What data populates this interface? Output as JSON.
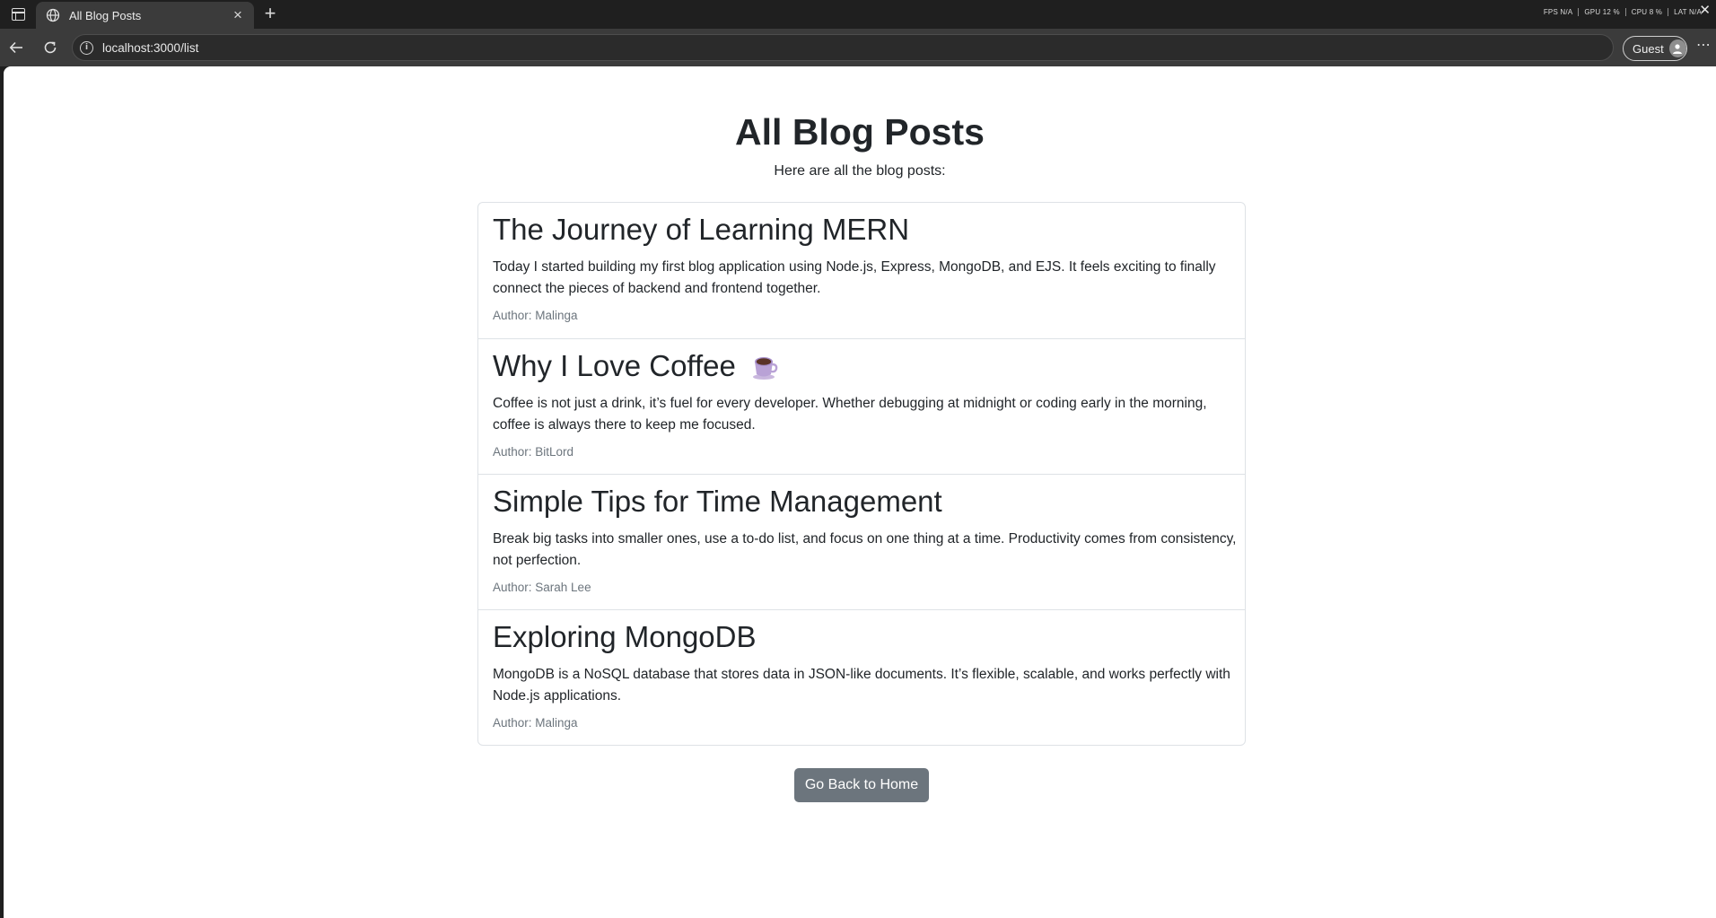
{
  "browser": {
    "tab": {
      "title": "All Blog Posts",
      "close_glyph": "×"
    },
    "new_tab_glyph": "+",
    "perf": [
      "FPS N/A",
      "GPU 12 %",
      "CPU 8 %",
      "LAT N/A"
    ],
    "window_close_glyph": "✕",
    "url": "localhost:3000/list",
    "profile_label": "Guest",
    "menu_glyph": "⋯"
  },
  "page": {
    "title": "All Blog Posts",
    "subtitle": "Here are all the blog posts:",
    "posts": [
      {
        "title": "The Journey of Learning MERN",
        "body": "Today I started building my first blog application using Node.js, Express, MongoDB, and EJS. It feels exciting to finally connect the pieces of backend and frontend together.",
        "author": "Author: Malinga"
      },
      {
        "title": "Why I Love Coffee",
        "title_icon": "coffee-cup-icon",
        "body": "Coffee is not just a drink, it’s fuel for every developer. Whether debugging at midnight or coding early in the morning, coffee is always there to keep me focused.",
        "author": "Author: BitLord"
      },
      {
        "title": "Simple Tips for Time Management",
        "body": "Break big tasks into smaller ones, use a to-do list, and focus on one thing at a time. Productivity comes from consistency, not perfection.",
        "author": "Author: Sarah Lee"
      },
      {
        "title": "Exploring MongoDB",
        "body": "MongoDB is a NoSQL database that stores data in JSON-like documents. It’s flexible, scalable, and works perfectly with Node.js applications.",
        "author": "Author: Malinga"
      }
    ],
    "back_button": "Go Back to Home"
  },
  "colors": {
    "button_bg": "#6c757d",
    "text": "#212529",
    "muted": "#6c757d",
    "border": "#dee2e6",
    "chrome_dark": "#1f1f1f",
    "chrome_toolbar": "#3b3b3b"
  }
}
